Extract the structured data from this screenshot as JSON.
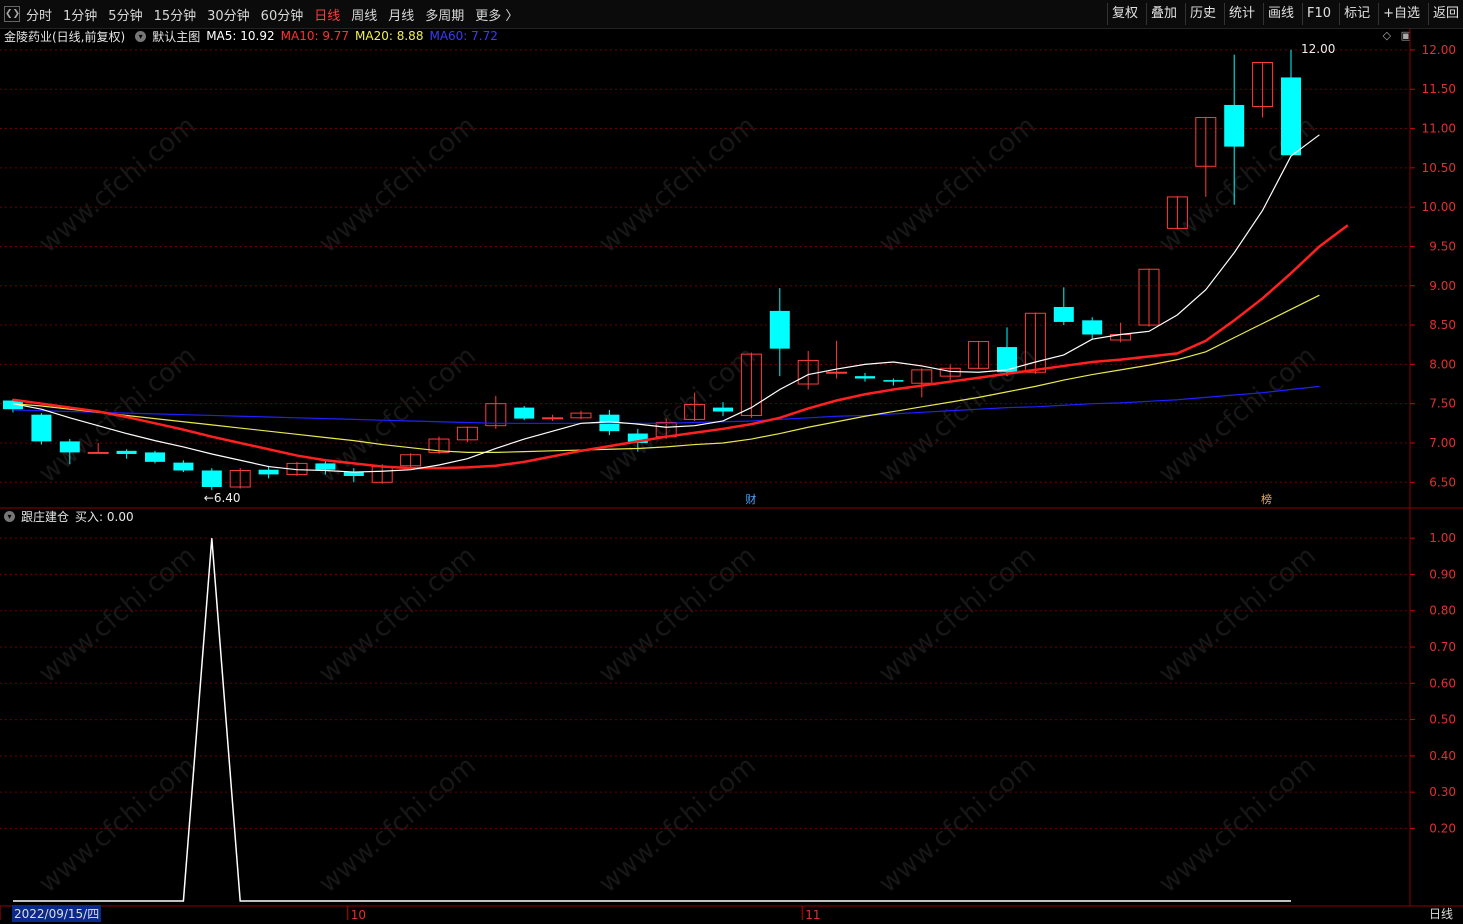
{
  "toolbar": {
    "periods": [
      "分时",
      "1分钟",
      "5分钟",
      "15分钟",
      "30分钟",
      "60分钟",
      "日线",
      "周线",
      "月线",
      "多周期",
      "更多 〉"
    ],
    "active_period": "日线",
    "actions": [
      "复权",
      "叠加",
      "历史",
      "统计",
      "画线",
      "F10",
      "标记",
      "+自选",
      "返回"
    ]
  },
  "main_header": {
    "stock": "金陵药业(日线,前复权)",
    "template": "默认主图",
    "ma5": "MA5: 10.92",
    "ma10": "MA10: 9.77",
    "ma20": "MA20: 8.88",
    "ma60": "MA60: 7.72"
  },
  "indicator_header": {
    "name": "跟庄建仓",
    "value": "买入: 0.00"
  },
  "colors": {
    "up": "#ff3b3b",
    "down": "#00ffff",
    "ma5": "#ffffff",
    "ma10": "#ff2020",
    "ma20": "#e8e850",
    "ma60": "#2020ff",
    "grid": "#6a0000"
  },
  "markers": {
    "cai": "财",
    "bang": "榜"
  },
  "bottom": {
    "date": "2022/09/15/四",
    "period": "日线"
  },
  "watermark": "www.cfchi.com",
  "chart_data": {
    "type": "candlestick",
    "y_axis_main": {
      "range": [
        6.3,
        12.05
      ],
      "ticks": [
        6.5,
        7.0,
        7.5,
        8.0,
        8.5,
        9.0,
        9.5,
        10.0,
        10.5,
        11.0,
        11.5,
        12.0
      ]
    },
    "y_axis_indicator": {
      "range": [
        0,
        1.05
      ],
      "ticks": [
        0.2,
        0.3,
        0.4,
        0.5,
        0.6,
        0.7,
        0.8,
        0.9,
        1.0
      ]
    },
    "x_labels": [
      {
        "index": 0,
        "label": "2022/09/15/四"
      },
      {
        "index": 12,
        "label": "10"
      },
      {
        "index": 28,
        "label": "11"
      }
    ],
    "candles": [
      [
        7.54,
        7.43,
        7.39,
        7.56
      ],
      [
        7.36,
        7.02,
        6.98,
        7.38
      ],
      [
        7.02,
        6.88,
        6.73,
        7.05
      ],
      [
        6.88,
        6.88,
        6.87,
        7.0
      ],
      [
        6.9,
        6.86,
        6.8,
        6.92
      ],
      [
        6.88,
        6.76,
        6.74,
        6.9
      ],
      [
        6.75,
        6.65,
        6.63,
        6.78
      ],
      [
        6.65,
        6.44,
        6.4,
        6.68
      ],
      [
        6.44,
        6.65,
        6.42,
        6.68
      ],
      [
        6.66,
        6.6,
        6.55,
        6.71
      ],
      [
        6.6,
        6.74,
        6.58,
        6.76
      ],
      [
        6.74,
        6.66,
        6.6,
        6.79
      ],
      [
        6.63,
        6.58,
        6.5,
        6.68
      ],
      [
        6.5,
        6.7,
        6.48,
        6.73
      ],
      [
        6.71,
        6.85,
        6.68,
        6.87
      ],
      [
        6.88,
        7.05,
        6.86,
        7.08
      ],
      [
        7.04,
        7.2,
        7.01,
        7.21
      ],
      [
        7.22,
        7.5,
        7.18,
        7.6
      ],
      [
        7.45,
        7.31,
        7.29,
        7.47
      ],
      [
        7.32,
        7.32,
        7.28,
        7.36
      ],
      [
        7.32,
        7.38,
        7.3,
        7.41
      ],
      [
        7.36,
        7.15,
        7.1,
        7.42
      ],
      [
        7.12,
        7.0,
        6.89,
        7.18
      ],
      [
        7.08,
        7.26,
        7.05,
        7.31
      ],
      [
        7.3,
        7.49,
        7.28,
        7.64
      ],
      [
        7.45,
        7.4,
        7.34,
        7.52
      ],
      [
        7.35,
        8.13,
        7.32,
        8.15
      ],
      [
        8.68,
        8.2,
        7.85,
        8.97
      ],
      [
        7.75,
        8.05,
        7.68,
        8.17
      ],
      [
        7.89,
        7.9,
        7.82,
        8.3
      ],
      [
        7.85,
        7.82,
        7.78,
        7.89
      ],
      [
        7.8,
        7.78,
        7.73,
        7.82
      ],
      [
        7.76,
        7.93,
        7.58,
        7.95
      ],
      [
        7.85,
        7.95,
        7.8,
        8.0
      ],
      [
        7.95,
        8.29,
        7.94,
        8.3
      ],
      [
        8.22,
        7.9,
        7.85,
        8.47
      ],
      [
        7.9,
        8.65,
        7.88,
        8.66
      ],
      [
        8.73,
        8.54,
        8.5,
        8.98
      ],
      [
        8.56,
        8.38,
        8.32,
        8.6
      ],
      [
        8.31,
        8.38,
        8.28,
        8.53
      ],
      [
        8.5,
        9.21,
        8.48,
        9.22
      ],
      [
        9.73,
        10.13,
        9.72,
        10.14
      ],
      [
        10.52,
        11.14,
        10.13,
        11.15
      ],
      [
        11.3,
        10.77,
        10.03,
        11.94
      ],
      [
        11.28,
        11.84,
        11.14,
        11.84
      ],
      [
        11.65,
        10.66,
        10.66,
        12.0
      ]
    ],
    "ma5": [
      7.5,
      7.43,
      7.32,
      7.22,
      7.12,
      7.03,
      6.95,
      6.86,
      6.78,
      6.7,
      6.66,
      6.65,
      6.63,
      6.64,
      6.66,
      6.72,
      6.8,
      6.93,
      7.05,
      7.15,
      7.25,
      7.27,
      7.24,
      7.2,
      7.22,
      7.28,
      7.45,
      7.68,
      7.87,
      7.94,
      8.0,
      8.03,
      7.98,
      7.91,
      7.9,
      7.93,
      8.03,
      8.12,
      8.32,
      8.38,
      8.42,
      8.63,
      8.95,
      9.42,
      9.96,
      10.65,
      10.92
    ],
    "ma10": [
      7.55,
      7.5,
      7.45,
      7.4,
      7.33,
      7.25,
      7.17,
      7.08,
      7.0,
      6.92,
      6.84,
      6.78,
      6.74,
      6.7,
      6.68,
      6.68,
      6.69,
      6.71,
      6.76,
      6.83,
      6.9,
      6.96,
      7.02,
      7.08,
      7.13,
      7.18,
      7.24,
      7.32,
      7.44,
      7.54,
      7.62,
      7.68,
      7.73,
      7.78,
      7.83,
      7.88,
      7.93,
      7.98,
      8.03,
      8.06,
      8.1,
      8.14,
      8.3,
      8.56,
      8.84,
      9.16,
      9.5,
      9.77
    ],
    "ma20": [
      7.5,
      7.47,
      7.43,
      7.39,
      7.35,
      7.31,
      7.27,
      7.23,
      7.19,
      7.15,
      7.11,
      7.07,
      7.03,
      6.98,
      6.94,
      6.9,
      6.88,
      6.88,
      6.89,
      6.9,
      6.91,
      6.92,
      6.93,
      6.95,
      6.98,
      7.0,
      7.05,
      7.12,
      7.2,
      7.27,
      7.34,
      7.4,
      7.46,
      7.52,
      7.58,
      7.65,
      7.72,
      7.8,
      7.87,
      7.93,
      7.99,
      8.06,
      8.16,
      8.34,
      8.52,
      8.7,
      8.88
    ],
    "ma60": [
      7.42,
      7.41,
      7.4,
      7.39,
      7.38,
      7.37,
      7.36,
      7.35,
      7.34,
      7.33,
      7.32,
      7.31,
      7.3,
      7.29,
      7.28,
      7.27,
      7.26,
      7.25,
      7.25,
      7.25,
      7.25,
      7.25,
      7.25,
      7.25,
      7.26,
      7.27,
      7.28,
      7.3,
      7.32,
      7.34,
      7.35,
      7.37,
      7.39,
      7.41,
      7.43,
      7.45,
      7.46,
      7.48,
      7.5,
      7.51,
      7.53,
      7.55,
      7.58,
      7.61,
      7.64,
      7.68,
      7.72
    ],
    "indicator": [
      0,
      0,
      0,
      0,
      0,
      0,
      0,
      1,
      0,
      0,
      0,
      0,
      0,
      0,
      0,
      0,
      0,
      0,
      0,
      0,
      0,
      0,
      0,
      0,
      0,
      0,
      0,
      0,
      0,
      0,
      0,
      0,
      0,
      0,
      0,
      0,
      0,
      0,
      0,
      0,
      0,
      0,
      0,
      0,
      0,
      0
    ],
    "annotations": [
      {
        "index": 7,
        "text": "←6.40"
      },
      {
        "index": 45,
        "text": "12.00"
      }
    ]
  }
}
